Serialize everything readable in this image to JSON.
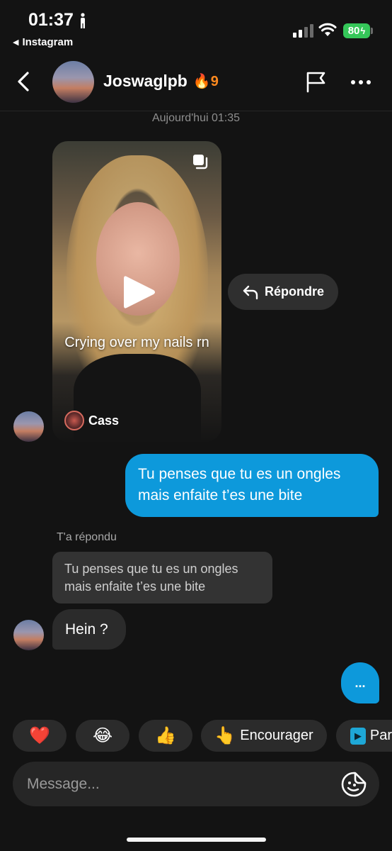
{
  "status_bar": {
    "time": "01:37",
    "back_app": "Instagram",
    "battery": "80"
  },
  "header": {
    "username": "Joswaglpb",
    "streak": "9",
    "back_icon": "chevron-left-icon",
    "flag_icon": "flag-icon",
    "more_icon": "more-horizontal-icon"
  },
  "conversation": {
    "timestamp": "Aujourd'hui 01:35",
    "reel": {
      "caption": "Crying over my nails rn",
      "author": "Cass"
    },
    "reply_label": "Répondre",
    "sent_message": "Tu penses que tu es un ongles mais enfaite t’es une bite",
    "replied_label": "T'a répondu",
    "quoted_message": "Tu penses que tu es un ongles mais enfaite t’es une bite",
    "received_message": "Hein ?",
    "typing_indicator": "..."
  },
  "quick_reactions": [
    {
      "emoji": "❤️",
      "label": ""
    },
    {
      "emoji": "😂",
      "label": ""
    },
    {
      "emoji": "👍",
      "label": ""
    },
    {
      "emoji": "👆",
      "label": "Encourager"
    },
    {
      "emoji": "▶",
      "label": "Par"
    }
  ],
  "composer": {
    "placeholder": "Message..."
  },
  "colors": {
    "background": "#131313",
    "sent_bubble": "#0d99db",
    "received_bubble": "#2b2b2b",
    "battery": "#35c759",
    "streak": "#ff8a1f"
  }
}
